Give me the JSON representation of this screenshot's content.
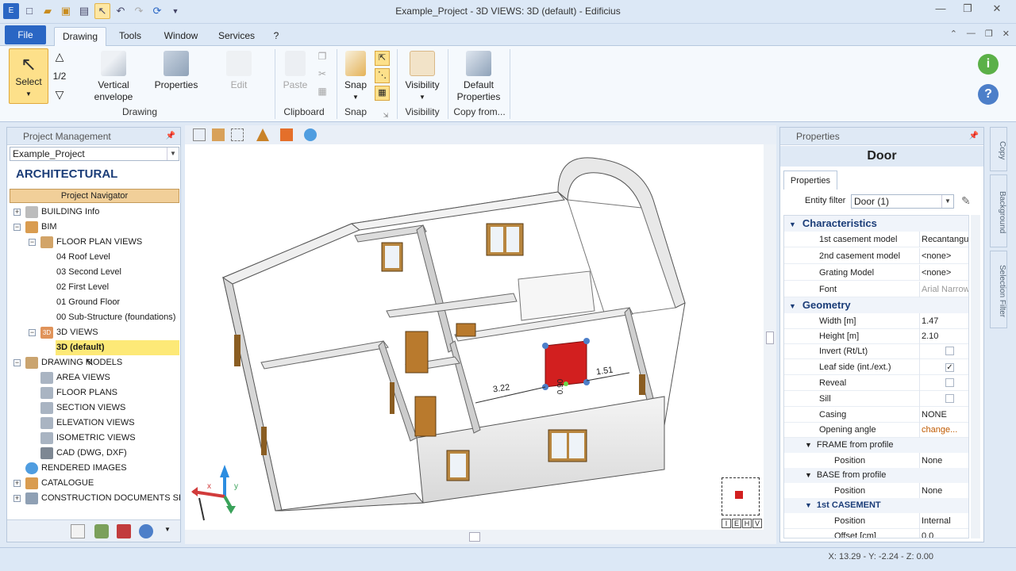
{
  "window": {
    "title": "Example_Project - 3D VIEWS: 3D (default) - Edificius"
  },
  "menu": {
    "file": "File",
    "tabs": [
      "Drawing",
      "Tools",
      "Window",
      "Services",
      "?"
    ]
  },
  "ribbon": {
    "select": "Select",
    "step": "1/2",
    "vertical_envelope": "Vertical envelope",
    "properties": "Properties",
    "edit": "Edit",
    "paste": "Paste",
    "snap": "Snap",
    "visibility": "Visibility",
    "default_properties": "Default Properties",
    "groups": {
      "drawing": "Drawing",
      "clipboard": "Clipboard",
      "snap": "Snap",
      "visibility": "Visibility",
      "copy_from": "Copy from..."
    }
  },
  "project_panel": {
    "title": "Project Management",
    "project_combo": "Example_Project",
    "heading": "ARCHITECTURAL",
    "navigator": "Project Navigator",
    "tree": [
      {
        "label": "BUILDING Info"
      },
      {
        "label": "BIM"
      },
      {
        "label": "FLOOR PLAN VIEWS"
      },
      {
        "label": "04 Roof Level"
      },
      {
        "label": "03 Second Level"
      },
      {
        "label": "02 First Level"
      },
      {
        "label": "01 Ground Floor"
      },
      {
        "label": "00 Sub-Structure (foundations)"
      },
      {
        "label": "3D VIEWS"
      },
      {
        "label": "3D (default)"
      },
      {
        "label": "DRAWING MODELS"
      },
      {
        "label": "AREA VIEWS"
      },
      {
        "label": "FLOOR PLANS"
      },
      {
        "label": "SECTION VIEWS"
      },
      {
        "label": "ELEVATION VIEWS"
      },
      {
        "label": "ISOMETRIC VIEWS"
      },
      {
        "label": "CAD (DWG, DXF)"
      },
      {
        "label": "RENDERED IMAGES"
      },
      {
        "label": "CATALOGUE"
      },
      {
        "label": "CONSTRUCTION DOCUMENTS SET"
      }
    ]
  },
  "viewport": {
    "dim1": "3.22",
    "dim2": "1.51",
    "dim3": "0.90",
    "axes": {
      "x": "x",
      "y": "y"
    },
    "viewcube_labels": [
      "I",
      "E",
      "H",
      "V"
    ]
  },
  "properties_panel": {
    "title": "Properties",
    "object": "Door",
    "tab": "Properties",
    "filter_label": "Entity filter",
    "filter_value": "Door (1)",
    "characteristics": "Characteristics",
    "rows_char": [
      {
        "name": "1st casement model",
        "value": "Recantangul"
      },
      {
        "name": "2nd casement model",
        "value": "<none>"
      },
      {
        "name": "Grating Model",
        "value": "<none>"
      },
      {
        "name": "Font",
        "value": "Arial Narrow"
      }
    ],
    "geometry": "Geometry",
    "width_label": "Width  [m]",
    "width_value": "1.47",
    "height_label": "Height  [m]",
    "height_value": "2.10",
    "invert_label": "Invert (Rt/Lt)",
    "leafside_label": "Leaf side (int./ext.)",
    "reveal_label": "Reveal",
    "sill_label": "Sill",
    "casing_label": "Casing",
    "casing_value": "NONE",
    "opening_label": "Opening angle",
    "opening_value": "change...",
    "frame_sub": "FRAME from profile",
    "frame_pos_label": "Position",
    "frame_pos_value": "None",
    "base_sub": "BASE from profile",
    "base_pos_label": "Position",
    "base_pos_value": "None",
    "casement_sub": "1st CASEMENT",
    "cas_pos_label": "Position",
    "cas_pos_value": "Internal",
    "offset_label": "Offset  [cm]",
    "offset_value": "0.0"
  },
  "side_tabs": [
    "Copy",
    "Background",
    "Selection Filter"
  ],
  "status": {
    "coords": "X: 13.29 - Y: -2.24 - Z: 0.00"
  },
  "colors": {
    "accent": "#2a66c4",
    "selected": "#fde08a",
    "door": "#d21f1f",
    "heading": "#1b3d78"
  }
}
